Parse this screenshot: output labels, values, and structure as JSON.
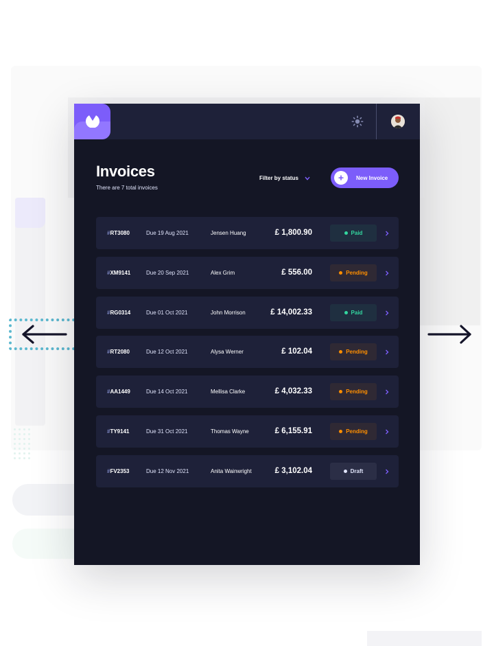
{
  "app": {
    "title": "Invoices",
    "subtitle": "There are 7 total invoices",
    "filter_label": "Filter by status",
    "new_invoice_label": "New Invoice"
  },
  "colors": {
    "accent": "#7c5dfa",
    "accent_light": "#9277ff",
    "background": "#141625",
    "card": "#1e2139",
    "paid": "#33d69f",
    "pending": "#ff8f00",
    "draft": "#e0e4fa"
  },
  "icons": {
    "logo": "logo-icon",
    "theme_toggle": "sun-icon",
    "avatar": "avatar",
    "filter": "chevron-down-icon",
    "new_invoice": "plus-icon",
    "row_arrow": "chevron-right-icon",
    "nav_left": "arrow-left-icon",
    "nav_right": "arrow-right-icon"
  },
  "invoices": [
    {
      "hash": "#",
      "id": "RT3080",
      "due": "Due  19 Aug 2021",
      "client": "Jensen Huang",
      "amount": "£ 1,800.90",
      "status": "Paid",
      "status_key": "paid"
    },
    {
      "hash": "#",
      "id": "XM9141",
      "due": "Due  20 Sep 2021",
      "client": "Alex Grim",
      "amount": "£ 556.00",
      "status": "Pending",
      "status_key": "pending"
    },
    {
      "hash": "#",
      "id": "RG0314",
      "due": "Due  01 Oct 2021",
      "client": "John Morrison",
      "amount": "£ 14,002.33",
      "status": "Paid",
      "status_key": "paid"
    },
    {
      "hash": "#",
      "id": "RT2080",
      "due": "Due  12 Oct 2021",
      "client": "Alysa Werner",
      "amount": "£ 102.04",
      "status": "Pending",
      "status_key": "pending"
    },
    {
      "hash": "#",
      "id": "AA1449",
      "due": "Due  14 Oct 2021",
      "client": "Mellisa Clarke",
      "amount": "£ 4,032.33",
      "status": "Pending",
      "status_key": "pending"
    },
    {
      "hash": "#",
      "id": "TY9141",
      "due": "Due  31 Oct 2021",
      "client": "Thomas Wayne",
      "amount": "£ 6,155.91",
      "status": "Pending",
      "status_key": "pending"
    },
    {
      "hash": "#",
      "id": "FV2353",
      "due": "Due  12 Nov 2021",
      "client": "Anita Wainwright",
      "amount": "£ 3,102.04",
      "status": "Draft",
      "status_key": "draft"
    }
  ]
}
